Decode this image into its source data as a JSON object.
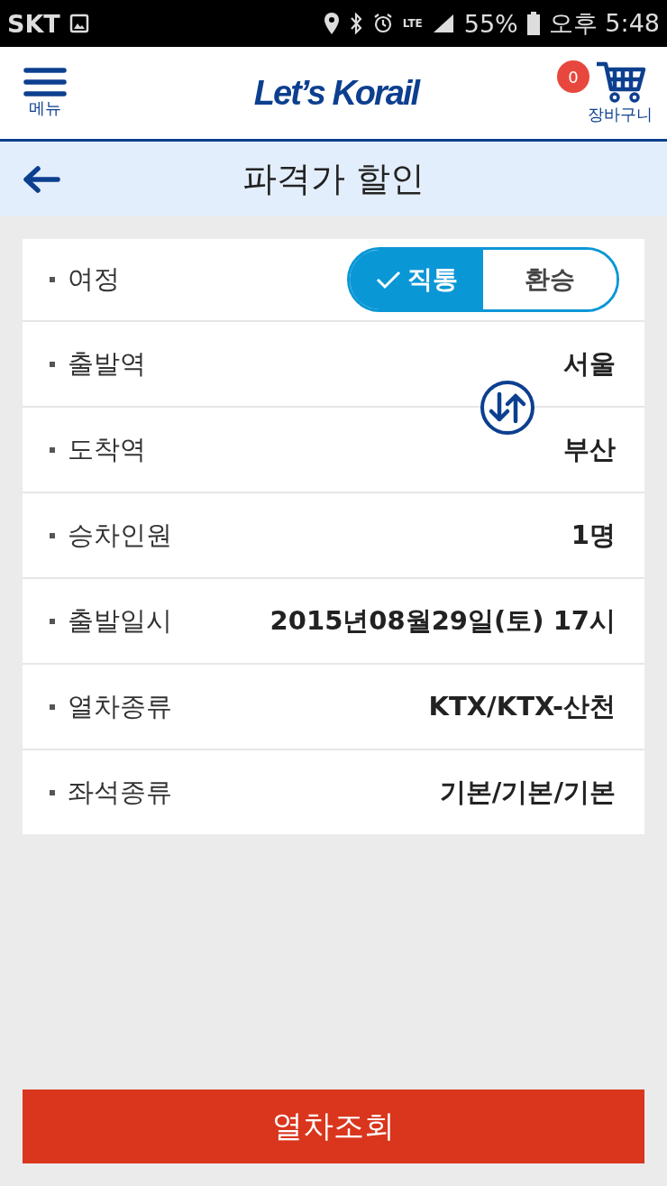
{
  "status_bar": {
    "carrier": "SKT",
    "network": "LTE",
    "battery": "55%",
    "time": "오후 5:48"
  },
  "header": {
    "menu_label": "메뉴",
    "logo": "Let’s Korail",
    "cart_count": "0",
    "cart_label": "장바구니"
  },
  "page_title": "파격가 할인",
  "form_rows": [
    {
      "kind": "toggle",
      "label": "여정",
      "options": [
        {
          "label": "직통",
          "selected": true
        },
        {
          "label": "환승",
          "selected": false
        }
      ]
    },
    {
      "kind": "value",
      "label": "출발역",
      "value": "서울"
    },
    {
      "kind": "value",
      "label": "도착역",
      "value": "부산"
    },
    {
      "kind": "value",
      "label": "승차인원",
      "value": "1명"
    },
    {
      "kind": "value",
      "label": "출발일시",
      "value": "2015년08월29일(토) 17시"
    },
    {
      "kind": "value",
      "label": "열차종류",
      "value": "KTX/KTX-산천"
    },
    {
      "kind": "value",
      "label": "좌석종류",
      "value": "기본/기본/기본"
    }
  ],
  "search_button": "열차조회"
}
